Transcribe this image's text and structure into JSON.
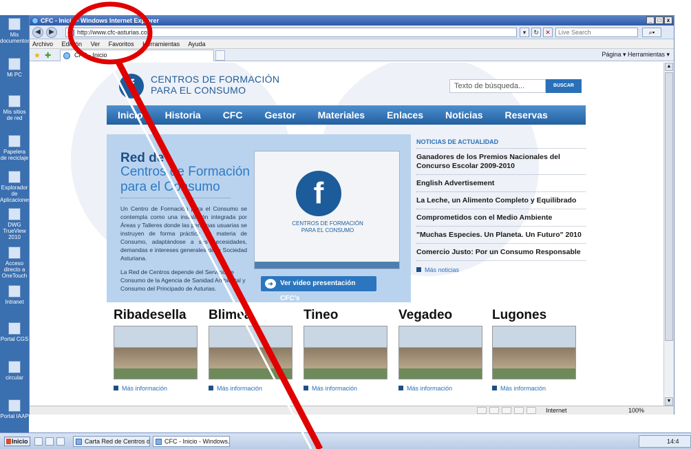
{
  "desktop": {
    "icons": [
      "Mis documentos",
      "Mi PC",
      "Mis sitios de red",
      "Papelera de reciclaje",
      "Explorador de Aplicaciones",
      "DWG TrueView 2010",
      "Acceso directo a OneTouch",
      "Intranet",
      "Portal CGS",
      "circular",
      "Portal IAAP"
    ]
  },
  "window": {
    "title": "CFC - Inicio - Windows Internet Explorer",
    "buttons": [
      "_",
      "□",
      "x"
    ]
  },
  "address": {
    "url": "http://www.cfc-asturias.co",
    "search_placeholder": "Live Search"
  },
  "menubar": [
    "Archivo",
    "Edición",
    "Ver",
    "Favoritos",
    "Herramientas",
    "Ayuda"
  ],
  "tab": {
    "label": "CFC - Inicio"
  },
  "commandbar": {
    "text": "Página ▾  Herramientas ▾"
  },
  "site": {
    "brand_line1": "CENTROS DE FORMACIÓN",
    "brand_line2": "PARA EL CONSUMO",
    "search_placeholder": "Texto de búsqueda...",
    "search_button": "BUSCAR",
    "nav": [
      "Inicio",
      "Historia",
      "CFC",
      "Gestor",
      "Materiales",
      "Enlaces",
      "Noticias",
      "Reservas"
    ],
    "hero": {
      "title": "Red de",
      "subtitle1": "Centros de Formación",
      "subtitle2": "para el Consumo",
      "text1": "Un Centro de Formación para el Consumo se contempla como una instalación integrada por Áreas y Talleres donde las personas usuarias se instruyen de forma práctica en materia de Consumo, adaptándose a sus necesidades, demandas e intereses generales de la Sociedad Asturiana.",
      "text2": "La Red de Centros depende del Servicio de Consumo de la Agencia de Sanidad Ambiental y Consumo del Principado de Asturias.",
      "video_caption1": "CENTROS DE FORMACIÓN",
      "video_caption2": "PARA EL CONSUMO",
      "video_button": "Ver video presentación CFC's"
    },
    "news": {
      "heading": "NOTICIAS DE ACTUALIDAD",
      "items": [
        "Ganadores de los Premios Nacionales del Concurso Escolar 2009-2010",
        "English Advertisement",
        "La Leche, un Alimento Completo y Equilibrado",
        "Comprometidos con el Medio Ambiente",
        "\"Muchas Especies. Un Planeta. Un Futuro\" 2010",
        "Comercio Justo: Por un Consumo Responsable"
      ],
      "more": "Más noticias"
    },
    "cities": [
      {
        "name": "Ribadesella",
        "more": "Más información"
      },
      {
        "name": "Blimea",
        "more": "Más información"
      },
      {
        "name": "Tineo",
        "more": "Más información"
      },
      {
        "name": "Vegadeo",
        "more": "Más información"
      },
      {
        "name": "Lugones",
        "more": "Más información"
      }
    ]
  },
  "statusbar": {
    "zone": "Internet",
    "zoom": "100%"
  },
  "taskbar": {
    "start": "Inicio",
    "tasks": [
      "Carta Red de Centros de...",
      "CFC - Inicio - Windows..."
    ],
    "clock": "14:4"
  },
  "colors": {
    "nav": "#23609f",
    "accent": "#2a70b8",
    "annotation": "#e00000"
  }
}
